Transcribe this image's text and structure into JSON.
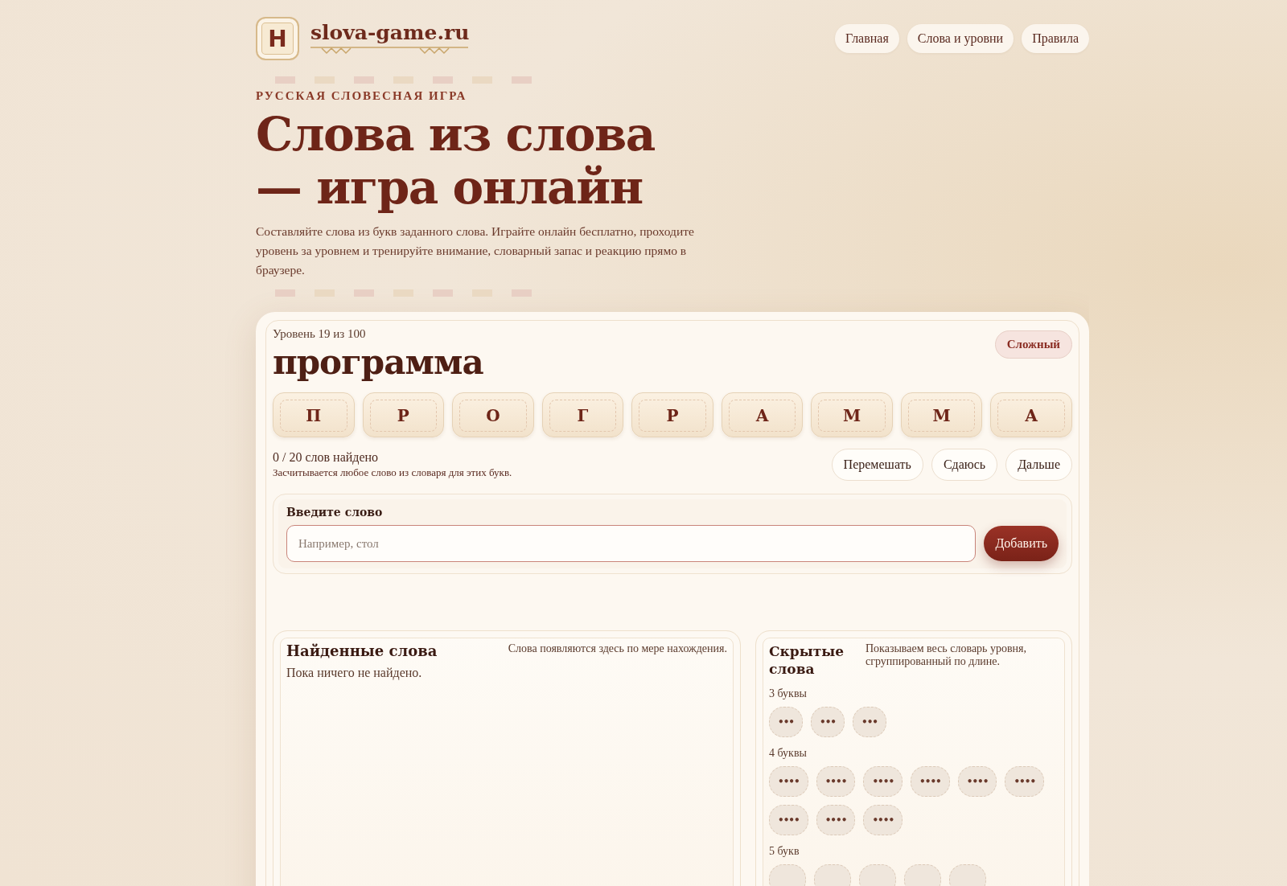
{
  "header": {
    "logo": {
      "mark": "Н",
      "site": "slova-game.ru"
    },
    "nav": [
      {
        "label": "Главная"
      },
      {
        "label": "Слова и уровни"
      },
      {
        "label": "Правила"
      }
    ]
  },
  "hero": {
    "kicker": "РУССКАЯ СЛОВЕСНАЯ ИГРА",
    "title_lines": [
      "Слова из слова",
      "— игра онлайн"
    ],
    "description": "Составляйте слова из букв заданного слова. Играйте онлайн бесплатно, проходите уровень за уровнем и тренируйте внимание, словарный запас и реакцию прямо в браузере."
  },
  "game": {
    "level": "Уровень 19 из 100",
    "difficulty": "Сложный",
    "word": "программа",
    "letters": [
      "П",
      "Р",
      "О",
      "Г",
      "Р",
      "А",
      "М",
      "М",
      "А"
    ],
    "progress": "0 / 20 слов найдено",
    "note": "Засчитывается любое слово из словаря для этих букв.",
    "actions": [
      {
        "label": "Перемешать"
      },
      {
        "label": "Сдаюсь"
      },
      {
        "label": "Дальше"
      }
    ],
    "input": {
      "label": "Введите слово",
      "placeholder": "Например, стол",
      "submit": "Добавить"
    },
    "found": {
      "title": "Найденные слова",
      "hint": "Слова появляются здесь по мере нахождения.",
      "empty": "Пока ничего не найдено."
    },
    "hidden": {
      "title": "Скрытые слова",
      "hint": "Показываем весь словарь уровня, сгруппированный по длине.",
      "groups": [
        {
          "label": "3 буквы",
          "words": [
            {
              "mask": "•••",
              "revealed": false
            },
            {
              "mask": "•••",
              "revealed": false
            },
            {
              "mask": "•••",
              "revealed": false
            }
          ]
        },
        {
          "label": "4 буквы",
          "words": [
            {
              "mask": "••••",
              "revealed": false
            },
            {
              "mask": "••••",
              "revealed": false
            },
            {
              "mask": "••••",
              "revealed": false
            },
            {
              "mask": "••••",
              "revealed": false
            },
            {
              "mask": "••••",
              "revealed": false
            },
            {
              "mask": "••••",
              "revealed": false
            },
            {
              "mask": "••••",
              "revealed": false
            },
            {
              "mask": "••••",
              "revealed": false
            },
            {
              "mask": "••••",
              "revealed": false
            }
          ]
        },
        {
          "label": "5 букв",
          "words": [
            {
              "revealed": false
            },
            {
              "revealed": false
            },
            {
              "revealed": false
            },
            {
              "revealed": false
            },
            {
              "revealed": false
            }
          ]
        }
      ]
    }
  }
}
